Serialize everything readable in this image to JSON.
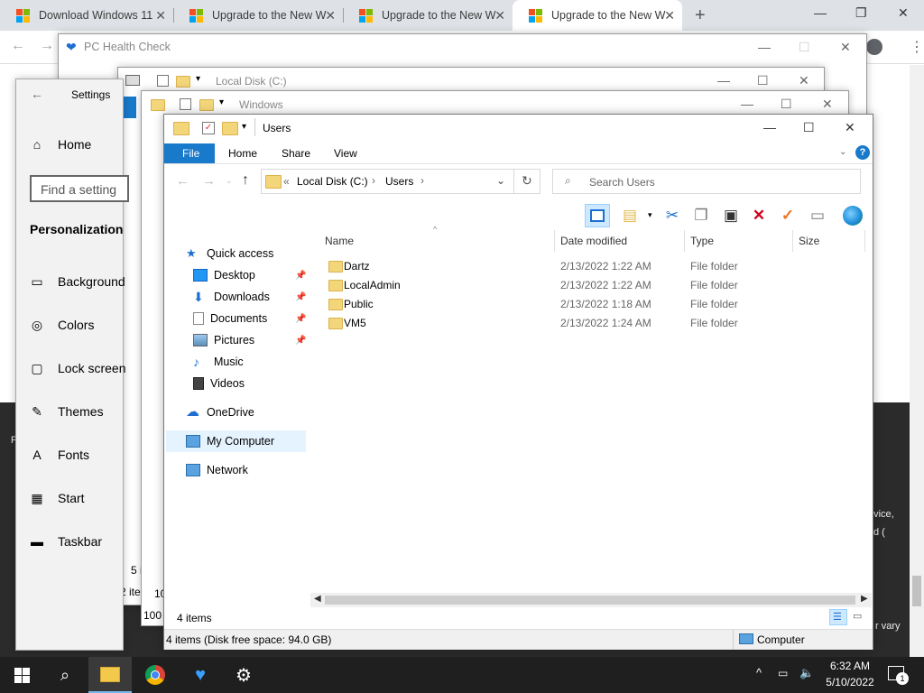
{
  "browser": {
    "tabs": [
      {
        "title": "Download Windows 11",
        "active": false
      },
      {
        "title": "Upgrade to the New W",
        "active": false
      },
      {
        "title": "Upgrade to the New W",
        "active": false
      },
      {
        "title": "Upgrade to the New W",
        "active": true
      }
    ],
    "new_tab": "+",
    "minimize": "—",
    "maximize": "❐",
    "close": "✕"
  },
  "background_page": {
    "right_text_1": "evice,",
    "right_text_2": "d (",
    "right_text_3": "r vary",
    "left_letter": "F"
  },
  "health_check": {
    "title": "PC Health Check"
  },
  "settings": {
    "title": "Settings",
    "home": "Home",
    "search_placeholder": "Find a setting",
    "section": "Personalization",
    "items": [
      {
        "label": "Background",
        "icon": "image-icon"
      },
      {
        "label": "Colors",
        "icon": "palette-icon"
      },
      {
        "label": "Lock screen",
        "icon": "lock-screen-icon"
      },
      {
        "label": "Themes",
        "icon": "themes-icon"
      },
      {
        "label": "Fonts",
        "icon": "fonts-icon"
      },
      {
        "label": "Start",
        "icon": "start-icon"
      },
      {
        "label": "Taskbar",
        "icon": "taskbar-icon"
      }
    ]
  },
  "local_disk_window": {
    "title": "Local Disk (C:)",
    "status": "5 i",
    "status2": "2 ite"
  },
  "windows_window": {
    "title": "Windows",
    "status": "100 i",
    "status2": "10"
  },
  "explorer": {
    "title": "Users",
    "ribbon_tabs": [
      "File",
      "Home",
      "Share",
      "View"
    ],
    "breadcrumb": {
      "prefix": "«",
      "parts": [
        "Local Disk (C:)",
        "Users"
      ]
    },
    "search_placeholder": "Search Users",
    "nav": {
      "quick_access": "Quick access",
      "items": [
        {
          "label": "Desktop",
          "pinned": true
        },
        {
          "label": "Downloads",
          "pinned": true
        },
        {
          "label": "Documents",
          "pinned": true
        },
        {
          "label": "Pictures",
          "pinned": true
        },
        {
          "label": "Music",
          "pinned": false
        },
        {
          "label": "Videos",
          "pinned": false
        }
      ],
      "onedrive": "OneDrive",
      "my_computer": "My Computer",
      "network": "Network"
    },
    "columns": [
      "Name",
      "Date modified",
      "Type",
      "Size"
    ],
    "files": [
      {
        "name": "Dartz",
        "date": "2/13/2022 1:22 AM",
        "type": "File folder",
        "size": ""
      },
      {
        "name": "LocalAdmin",
        "date": "2/13/2022 1:22 AM",
        "type": "File folder",
        "size": ""
      },
      {
        "name": "Public",
        "date": "2/13/2022 1:18 AM",
        "type": "File folder",
        "size": ""
      },
      {
        "name": "VM5",
        "date": "2/13/2022 1:24 AM",
        "type": "File folder",
        "size": ""
      }
    ],
    "item_count": "4 items",
    "status_bar": "4 items (Disk free space: 94.0 GB)",
    "status_location": "Computer"
  },
  "taskbar": {
    "time": "6:32 AM",
    "date": "5/10/2022",
    "notification_count": "1"
  },
  "colors": {
    "accent": "#1a73e8",
    "file_tab": "#1979ca",
    "taskbar": "#1f1f1f"
  }
}
